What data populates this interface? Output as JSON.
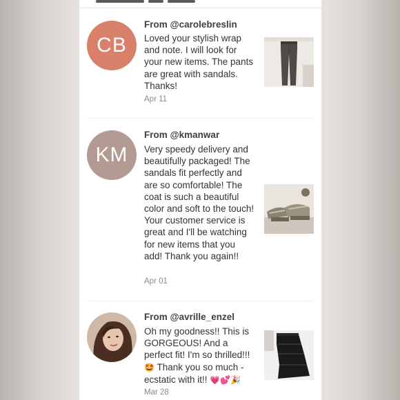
{
  "reviews": [
    {
      "initials": "CB",
      "avatar_color": "#d8806a",
      "from": "From @carolebreslin",
      "text": "Loved your stylish wrap and note. I will look for your new items. The pants are great with sandals. Thanks!",
      "date": "Apr 11",
      "item_image": "dark-trousers-thumbnail"
    },
    {
      "initials": "KM",
      "avatar_color": "#b39a92",
      "from": "From @kmanwar",
      "text": "Very speedy delivery and beautifully packaged! The sandals fit perfectly and are so comfortable! The coat is such a beautiful color and soft to the touch! Your customer service is great and I'll be watching for new items that you add! Thank you again!!",
      "date": "Apr 01",
      "item_image": "sandals-thumbnail"
    },
    {
      "initials": "",
      "avatar_color": "#8a6a5a",
      "from": "From @avrille_enzel",
      "text_main": "Oh my goodness!! This is GORGEOUS! And a perfect fit! I'm so thrilled!!! ",
      "emoji_1": "🤩",
      "text_tail": " Thank you so much - ecstatic with it!! ",
      "emoji_2": "💗💕🎉",
      "date": "Mar 28",
      "item_image": "ruffle-skirt-thumbnail"
    }
  ]
}
